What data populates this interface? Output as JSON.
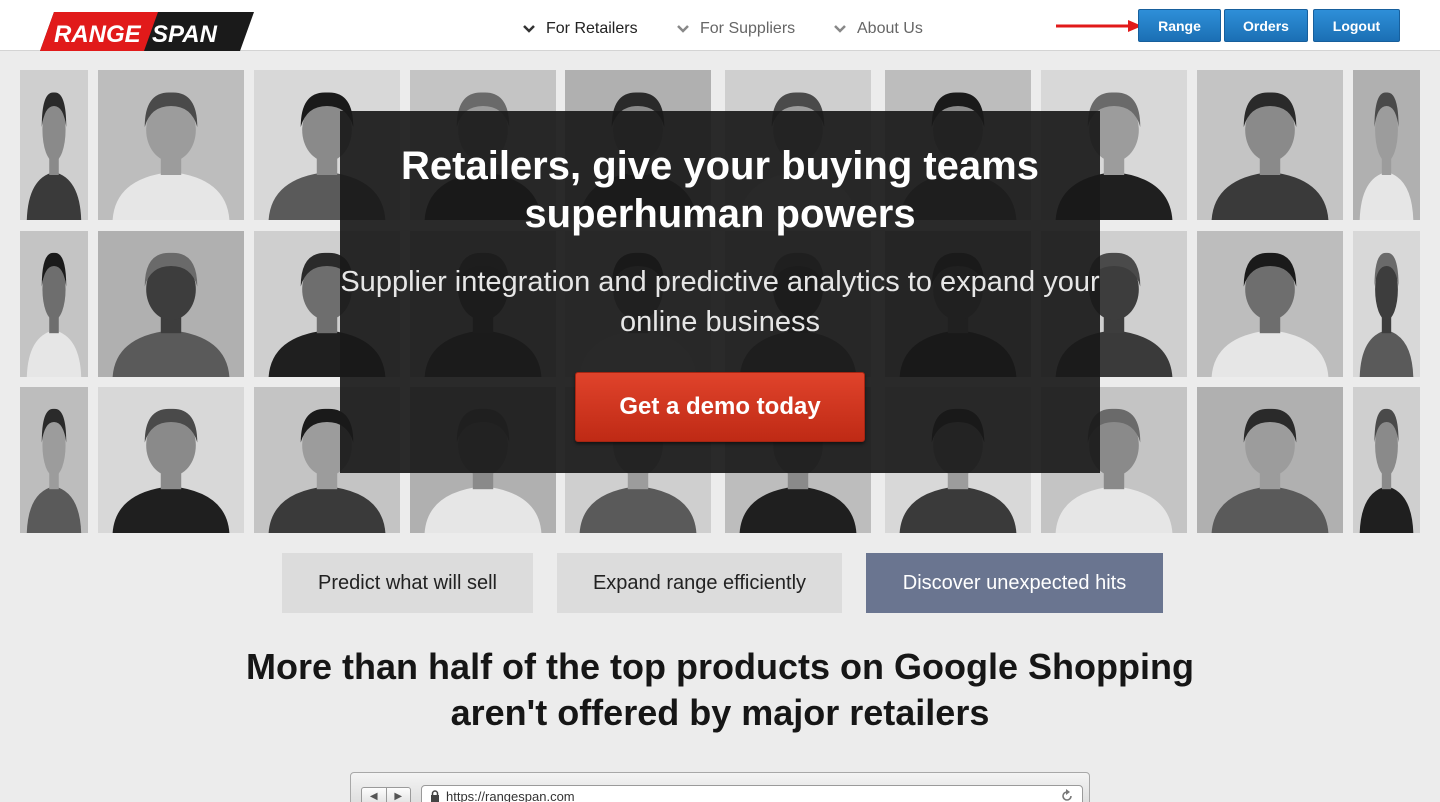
{
  "header": {
    "logo_text_left": "RANGE",
    "logo_text_right": "SPAN",
    "nav": [
      {
        "label": "For Retailers"
      },
      {
        "label": "For Suppliers"
      },
      {
        "label": "About Us"
      }
    ],
    "buttons": {
      "range": "Range",
      "orders": "Orders",
      "logout": "Logout"
    }
  },
  "hero": {
    "title": "Retailers, give your buying teams superhuman powers",
    "subtitle": "Supplier integration and predictive analytics to expand your online business",
    "cta": "Get a demo today"
  },
  "features": [
    {
      "label": "Predict what will sell"
    },
    {
      "label": "Expand range efficiently"
    },
    {
      "label": "Discover unexpected hits"
    }
  ],
  "headline": "More than half of the top products on Google Shopping aren't offered by major retailers",
  "browser": {
    "url": "https://rangespan.com",
    "back": "◀",
    "forward": "▶"
  },
  "colors": {
    "primary_button": "#1f78c1",
    "cta_red": "#d23a22",
    "active_feature": "#6a7590",
    "logo_red": "#e11a1a"
  }
}
